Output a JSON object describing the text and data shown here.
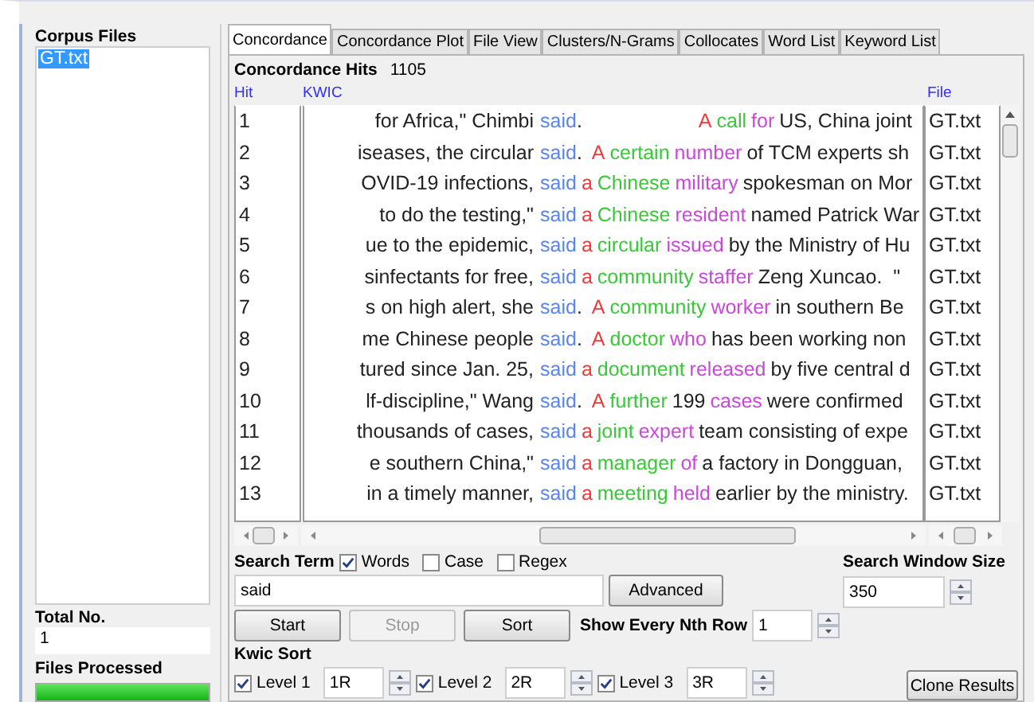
{
  "corpus_files": {
    "label": "Corpus Files",
    "items": [
      {
        "name": "GT.txt",
        "selected": true
      }
    ]
  },
  "totals": {
    "total_label": "Total No.",
    "total_value": "1",
    "processed_label": "Files Processed",
    "level": 1
  },
  "tabs": [
    {
      "label": "Concordance",
      "selected": true
    },
    {
      "label": "Concordance Plot",
      "selected": false
    },
    {
      "label": "File View",
      "selected": false
    },
    {
      "label": "Clusters/N-Grams",
      "selected": false
    },
    {
      "label": "Collocates",
      "selected": false
    },
    {
      "label": "Word List",
      "selected": false
    },
    {
      "label": "Keyword List",
      "selected": false
    }
  ],
  "concordance": {
    "hits_label": "Concordance Hits",
    "hits": "1105",
    "columns": [
      "Hit",
      "KWIC",
      "File"
    ],
    "rows": [
      {
        "hit": "1",
        "left": " for Africa,\" Chimbi",
        "node": "said",
        "punct": ".",
        "wide_gap": true,
        "right": [
          {
            "text": "A",
            "color": "#f03a3a"
          },
          {
            "text": "call",
            "color": "#38c838"
          },
          {
            "text": "for",
            "color": "#c848d8"
          },
          {
            "text": "US, China joint"
          }
        ],
        "file": "GT.txt"
      },
      {
        "hit": "2",
        "left": "iseases, the circular",
        "node": "said",
        "punct": ".",
        "right": [
          {
            "text": "A",
            "color": "#f03a3a"
          },
          {
            "text": "certain",
            "color": "#38c838"
          },
          {
            "text": "number",
            "color": "#c848d8"
          },
          {
            "text": "of TCM experts sh"
          }
        ],
        "file": "GT.txt"
      },
      {
        "hit": "3",
        "left": "OVID-19 infections,",
        "node": "said",
        "right": [
          {
            "text": "a",
            "color": "#f03a3a"
          },
          {
            "text": "Chinese",
            "color": "#38c838"
          },
          {
            "text": "military",
            "color": "#c848d8"
          },
          {
            "text": "spokesman on Mor"
          }
        ],
        "file": "GT.txt"
      },
      {
        "hit": "4",
        "left": "to do the testing,\"",
        "node": "said",
        "right": [
          {
            "text": "a",
            "color": "#f03a3a"
          },
          {
            "text": "Chinese",
            "color": "#38c838"
          },
          {
            "text": "resident",
            "color": "#c848d8"
          },
          {
            "text": "named Patrick War"
          }
        ],
        "file": "GT.txt"
      },
      {
        "hit": "5",
        "left": "ue to the epidemic,",
        "node": "said",
        "right": [
          {
            "text": "a",
            "color": "#f03a3a"
          },
          {
            "text": "circular",
            "color": "#38c838"
          },
          {
            "text": "issued",
            "color": "#c848d8"
          },
          {
            "text": "by the Ministry of Hu"
          }
        ],
        "file": "GT.txt"
      },
      {
        "hit": "6",
        "left": "sinfectants for free,",
        "node": "said",
        "right": [
          {
            "text": "a",
            "color": "#f03a3a"
          },
          {
            "text": "community",
            "color": "#38c838"
          },
          {
            "text": "staffer",
            "color": "#c848d8"
          },
          {
            "text": "Zeng Xuncao.  \""
          }
        ],
        "file": "GT.txt"
      },
      {
        "hit": "7",
        "left": "s on high alert, she",
        "node": "said",
        "punct": ".",
        "right": [
          {
            "text": "A",
            "color": "#f03a3a"
          },
          {
            "text": "community",
            "color": "#38c838"
          },
          {
            "text": "worker",
            "color": "#c848d8"
          },
          {
            "text": "in southern Be"
          }
        ],
        "file": "GT.txt"
      },
      {
        "hit": "8",
        "left": "me Chinese people",
        "node": "said",
        "punct": ".",
        "right": [
          {
            "text": "A",
            "color": "#f03a3a"
          },
          {
            "text": "doctor",
            "color": "#38c838"
          },
          {
            "text": "who",
            "color": "#c848d8"
          },
          {
            "text": "has been working non"
          }
        ],
        "file": "GT.txt"
      },
      {
        "hit": "9",
        "left": "tured since Jan. 25,",
        "node": "said",
        "right": [
          {
            "text": "a",
            "color": "#f03a3a"
          },
          {
            "text": "document",
            "color": "#38c838"
          },
          {
            "text": "released",
            "color": "#c848d8"
          },
          {
            "text": "by five central d"
          }
        ],
        "file": "GT.txt"
      },
      {
        "hit": "10",
        "left": "lf-discipline,\" Wang",
        "node": "said",
        "punct": ".",
        "right": [
          {
            "text": "A",
            "color": "#f03a3a"
          },
          {
            "text": "further",
            "color": "#38c838"
          },
          {
            "text": "199"
          },
          {
            "text": "cases",
            "color": "#c848d8"
          },
          {
            "text": "were confirmed"
          }
        ],
        "file": "GT.txt"
      },
      {
        "hit": "11",
        "left": "thousands of cases,",
        "node": "said",
        "right": [
          {
            "text": "a",
            "color": "#f03a3a"
          },
          {
            "text": "joint",
            "color": "#38c838"
          },
          {
            "text": "expert",
            "color": "#c848d8"
          },
          {
            "text": "team consisting of expe"
          }
        ],
        "file": "GT.txt"
      },
      {
        "hit": "12",
        "left": "e southern China,\"",
        "node": "said",
        "right": [
          {
            "text": "a",
            "color": "#f03a3a"
          },
          {
            "text": "manager",
            "color": "#38c838"
          },
          {
            "text": "of",
            "color": "#c848d8"
          },
          {
            "text": "a factory in Dongguan,"
          }
        ],
        "file": "GT.txt"
      },
      {
        "hit": "13",
        "left": "in a timely manner,",
        "node": "said",
        "right": [
          {
            "text": "a",
            "color": "#f03a3a"
          },
          {
            "text": "meeting",
            "color": "#38c838"
          },
          {
            "text": "held",
            "color": "#c848d8"
          },
          {
            "text": "earlier by the ministry."
          }
        ],
        "file": "GT.txt"
      }
    ]
  },
  "search": {
    "label": "Search Term",
    "options": [
      {
        "label": "Words",
        "checked": true
      },
      {
        "label": "Case",
        "checked": false
      },
      {
        "label": "Regex",
        "checked": false
      }
    ],
    "value": "said",
    "advanced": "Advanced",
    "window_label": "Search Window Size",
    "window_value": "350"
  },
  "buttons": [
    {
      "label": "Start",
      "disabled": false
    },
    {
      "label": "Stop",
      "disabled": true
    },
    {
      "label": "Sort",
      "disabled": false
    }
  ],
  "nth_row": {
    "label": "Show Every Nth Row",
    "value": "1"
  },
  "kwic_sort": {
    "label": "Kwic Sort",
    "levels": [
      {
        "label": "Level 1",
        "checked": true,
        "value": "1R"
      },
      {
        "label": "Level 2",
        "checked": true,
        "value": "2R"
      },
      {
        "label": "Level 3",
        "checked": true,
        "value": "3R"
      }
    ]
  },
  "clone_button": "Clone Results"
}
